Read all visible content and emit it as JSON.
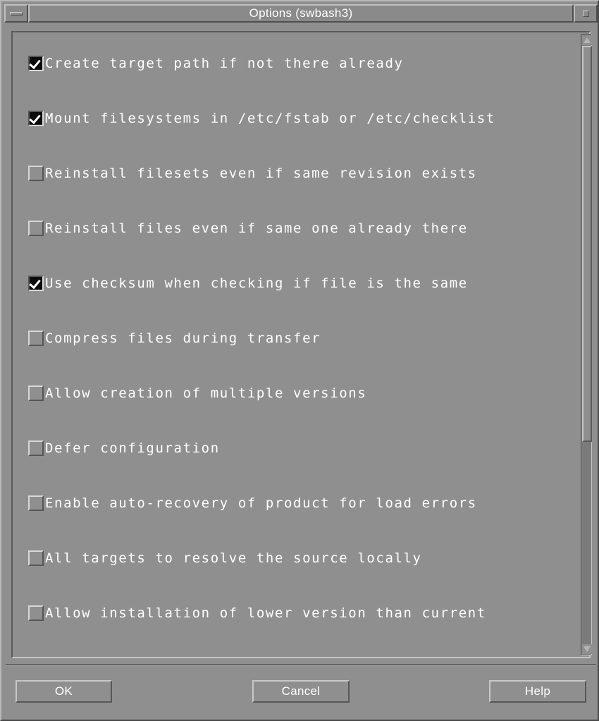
{
  "window": {
    "title": "Options (swbash3)",
    "minimize_label": "minimize",
    "maximize_label": "maximize",
    "colors": {
      "background": "#8f8f8f",
      "titlebar": "#8a8a8a",
      "text": "#ffffff",
      "checkbox_checked": "#0b0b0b",
      "bevel_light": "#d8d8d8",
      "bevel_dark": "#565656"
    }
  },
  "options": [
    {
      "label": "Create target path if not there already",
      "checked": true
    },
    {
      "label": "Mount filesystems in /etc/fstab or /etc/checklist",
      "checked": true
    },
    {
      "label": "Reinstall filesets even if same revision exists",
      "checked": false
    },
    {
      "label": "Reinstall files even if same one already there",
      "checked": false
    },
    {
      "label": "Use checksum when checking if file is the same",
      "checked": true
    },
    {
      "label": "Compress files during transfer",
      "checked": false
    },
    {
      "label": "Allow creation of multiple versions",
      "checked": false
    },
    {
      "label": "Defer configuration",
      "checked": false
    },
    {
      "label": "Enable auto-recovery of product for load errors",
      "checked": false
    },
    {
      "label": "All targets to resolve the source locally",
      "checked": false
    },
    {
      "label": "Allow installation of lower version than current",
      "checked": false
    }
  ],
  "scrollbar": {
    "orientation": "vertical",
    "up_arrow": "scroll-up",
    "down_arrow": "scroll-down",
    "thumb_position_percent": 0,
    "thumb_size_percent": 64
  },
  "buttons": {
    "ok": "OK",
    "cancel": "Cancel",
    "help": "Help"
  }
}
